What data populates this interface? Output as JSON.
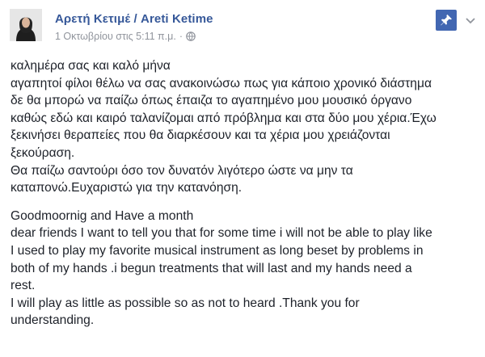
{
  "post": {
    "author": "Αρετή Κετιμέ / Areti Ketime",
    "timestamp": "1 Οκτωβρίου στις 5:11 π.μ.",
    "separator": "·",
    "icons": {
      "avatar": "profile-avatar",
      "audience": "globe-icon",
      "pin": "pin-icon",
      "menu": "chevron-down-icon"
    },
    "colors": {
      "author": "#365899",
      "meta": "#90949c",
      "pin_button": "#4267b2",
      "text": "#1d2129"
    },
    "greek_lines": [
      "καλημέρα σας και καλό μήνα",
      "αγαπητοί φίλοι θέλω να σας ανακοινώσω πως για κάποιο χρονικό διάστημα",
      "δε θα μπορώ να παίζω όπως έπαιζα το αγαπημένο μου μουσικό όργανο",
      "καθώς εδώ και καιρό ταλανίζομαι από πρόβλημα και στα δύο μου χέρια.Έχω",
      "ξεκινήσει θεραπείες που θα διαρκέσουν και τα χέρια μου χρειάζονται",
      "ξεκούραση.",
      "Θα παίζω σαντούρι όσο τον δυνατόν λιγότερο ώστε να μην τα",
      "καταπονώ.Ευχαριστώ για την κατανόηση."
    ],
    "english_lines": [
      "Goodmoornig and Have a month",
      "dear friends I want to tell you that for some time i will not be able to play like",
      "I used to play my favorite musical instrument as long beset by problems in",
      "both of my hands .i begun treatments that will last and my hands need a",
      "rest.",
      "I will play as little as possible so as not to heard .Thank you for",
      "understanding."
    ]
  }
}
